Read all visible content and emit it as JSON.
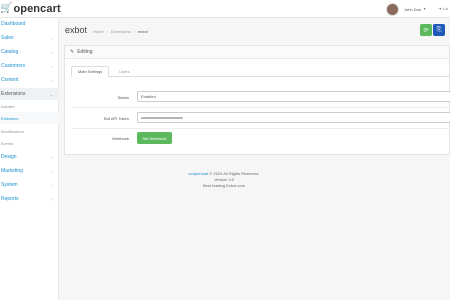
{
  "header": {
    "logo_text": "opencart",
    "user_name": "John Doe",
    "logout_label": "Lo"
  },
  "sidebar": {
    "items": [
      {
        "label": "Dashboard"
      },
      {
        "label": "Sales",
        "chevron": "›"
      },
      {
        "label": "Catalog",
        "chevron": "›"
      },
      {
        "label": "Customers",
        "chevron": "›"
      },
      {
        "label": "Content",
        "chevron": "›"
      },
      {
        "label": "Extensions",
        "chevron": "⌄"
      },
      {
        "label": "Design",
        "chevron": "›"
      },
      {
        "label": "Marketing",
        "chevron": "›"
      },
      {
        "label": "System",
        "chevron": "›"
      },
      {
        "label": "Reports",
        "chevron": "›"
      }
    ],
    "sub_items": [
      {
        "label": "Installer"
      },
      {
        "label": "Extension"
      },
      {
        "label": "Modifications"
      },
      {
        "label": "Events"
      }
    ]
  },
  "page": {
    "title": "exbot",
    "breadcrumb": [
      "Home",
      "Extensions",
      "exbot"
    ]
  },
  "card": {
    "heading": "Editing",
    "tabs": [
      "Main Settings",
      "Users"
    ],
    "fields": {
      "status_label": "Status",
      "status_value": "Enabled",
      "token_label": "Bot API Token",
      "token_value": "••••••••••••••••••••••••••••••••••••••••••••••",
      "webhook_label": "Webhook",
      "webhook_button": "Set Webhook"
    }
  },
  "footer": {
    "line1_link": "exopencart",
    "line1_rest": " © 2024 All Rights Reserved.",
    "line2": "Version 3.0",
    "line3": "Best hosting Exbot.com"
  },
  "colors": {
    "accent": "#1e91cf",
    "save_green": "#5cb85c",
    "back_blue": "#1e5ab9"
  },
  "icons": {
    "save": "save-icon",
    "back": "reply-icon",
    "editing": "pencil-icon",
    "cart": "shopping-cart-icon"
  }
}
